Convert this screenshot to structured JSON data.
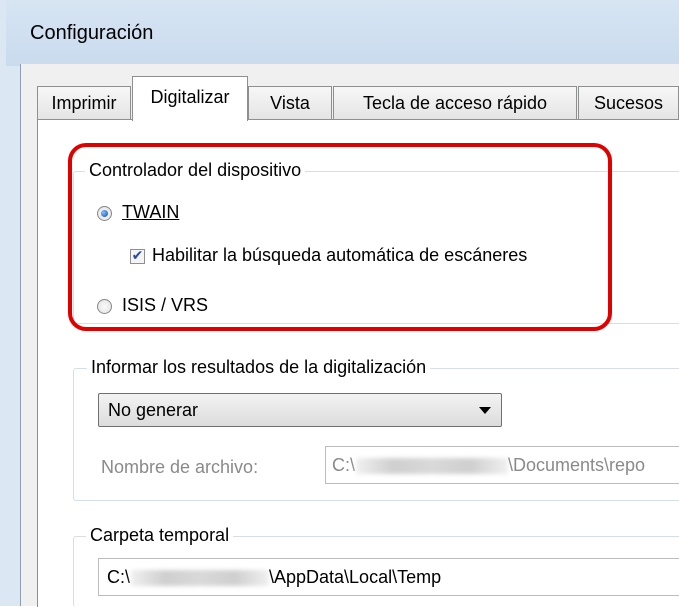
{
  "window": {
    "title": "Configuración"
  },
  "tabs": [
    {
      "label": "Imprimir"
    },
    {
      "label": "Digitalizar",
      "active": true
    },
    {
      "label": "Vista"
    },
    {
      "label": "Tecla de acceso rápido"
    },
    {
      "label": "Sucesos"
    }
  ],
  "device_group": {
    "label": "Controlador del dispositivo",
    "twain_label": "TWAIN",
    "twain_selected": true,
    "auto_search_label": "Habilitar la búsqueda automática de escáneres",
    "auto_search_checked": true,
    "isis_label": "ISIS / VRS",
    "isis_selected": false
  },
  "results_group": {
    "label": "Informar los resultados de la digitalización",
    "selected_option": "No generar",
    "filename_label": "Nombre de archivo:",
    "filename_prefix": "C:\\",
    "filename_suffix": "\\Documents\\repo"
  },
  "temp_group": {
    "label": "Carpeta temporal",
    "path_prefix": "C:\\",
    "path_suffix": "\\AppData\\Local\\Temp"
  },
  "colors": {
    "highlight": "#e00000",
    "radio_selected": "#1e63b8",
    "checkmark": "#2a4a9c"
  }
}
